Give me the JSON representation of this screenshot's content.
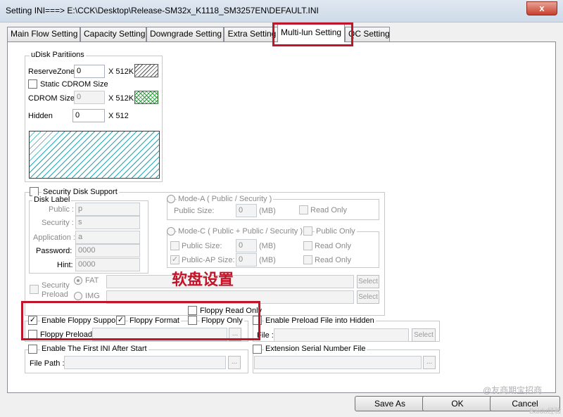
{
  "window": {
    "title": "Setting  INI===> E:\\CCK\\Desktop\\Release-SM32x_K1118_SM3257EN\\DEFAULT.INI",
    "close_glyph": "x"
  },
  "tabs": [
    {
      "label": "Main Flow Setting"
    },
    {
      "label": "Capacity Setting"
    },
    {
      "label": "Downgrade Setting"
    },
    {
      "label": "Extra Setting"
    },
    {
      "label": "Multi-lun Setting",
      "active": true
    },
    {
      "label": "QC Setting"
    }
  ],
  "udisk": {
    "group_label": "uDisk Paritiions",
    "reserve_zone_label": "ReserveZone",
    "reserve_zone_value": "0",
    "reserve_zone_unit": "X 512K",
    "static_cdrom_label": "Static CDROM Size",
    "cdrom_size_label": "CDROM Size",
    "cdrom_size_value": "0",
    "cdrom_size_unit": "X 512K",
    "hidden_label": "Hidden",
    "hidden_value": "0",
    "hidden_unit": "X 512"
  },
  "security": {
    "group_label": "Security Disk Support",
    "disk_label_group": "Disk Label",
    "public_label": "Public :",
    "public_value": "p",
    "security_label": "Security :",
    "security_value": "s",
    "application_label": "Application :",
    "application_value": "a",
    "password_label": "Password:",
    "password_value": "0000",
    "hint_label": "Hint:",
    "hint_value": "0000",
    "mode_a_label": "Mode-A ( Public / Security )",
    "public_size_label": "Public Size:",
    "public_size_value": "0",
    "public_size_unit": "(MB)",
    "read_only_label": "Read Only",
    "mode_c_label": "Mode-C ( Public + Public / Security )",
    "public_only_label": "Public Only",
    "public_size2_label": "Public Size:",
    "public_size2_value": "0",
    "public_size2_unit": "(MB)",
    "read_only2_label": "Read Only",
    "public_ap_label": "Public-AP Size:",
    "public_ap_value": "0",
    "public_ap_unit": "(MB)",
    "read_only3_label": "Read Only",
    "preload_label_1": "Security",
    "preload_label_2": "Preload",
    "fat_label": "FAT",
    "img_label": "IMG",
    "select_label": "Select",
    "select2_label": "Select"
  },
  "annotation": "软盘设置",
  "floppy": {
    "read_only_label": "Floppy Read Only",
    "enable_label": "Enable Floppy Support",
    "format_label": "Floppy Format",
    "floppy_only_label": "Floppy Only",
    "preload_label": "Floppy Preload",
    "browse_label": "..."
  },
  "preload_hidden": {
    "label": "Enable Preload File into Hidden",
    "file_label": "File :",
    "select_label": "Select"
  },
  "first_ini": {
    "label": "Enable The First INI After Start",
    "file_path_label": "File Path :",
    "browse_label": "..."
  },
  "extension_serial": {
    "label": "Extension Serial Number File",
    "browse_label": "..."
  },
  "footer": {
    "save_as": "Save As",
    "ok": "OK",
    "cancel": "Cancel"
  },
  "watermark": "@友商期宝招商",
  "watermark_logo": "Baidu经验"
}
